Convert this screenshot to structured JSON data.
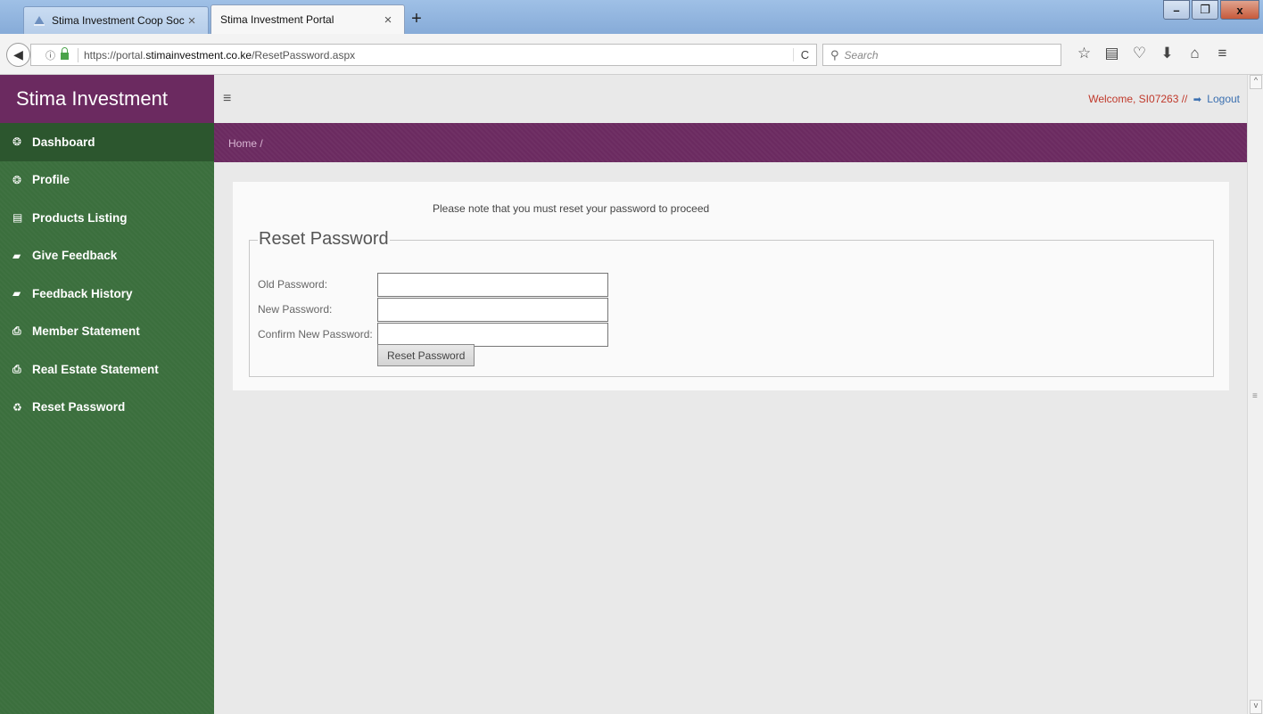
{
  "browser": {
    "tabs": [
      {
        "label": "Stima Investment Coop Soci",
        "active": false
      },
      {
        "label": "Stima Investment Portal",
        "active": true
      }
    ],
    "url_prefix": "https://portal.",
    "url_domain": "stimainvestment.co.ke",
    "url_path": "/ResetPassword.aspx",
    "search_placeholder": "Search",
    "window_buttons": {
      "minimize": "–",
      "restore": "❐",
      "close": "x"
    },
    "tab_close": "×",
    "new_tab": "+",
    "reload": "C"
  },
  "sidebar": {
    "brand": "Stima Investment",
    "items": [
      {
        "label": "Dashboard",
        "icon": "dashboard-icon",
        "glyph": "❂"
      },
      {
        "label": "Profile",
        "icon": "dashboard-icon",
        "glyph": "❂"
      },
      {
        "label": "Products Listing",
        "icon": "list-icon",
        "glyph": "▤"
      },
      {
        "label": "Give Feedback",
        "icon": "book-icon",
        "glyph": "▰"
      },
      {
        "label": "Feedback History",
        "icon": "book-icon",
        "glyph": "▰"
      },
      {
        "label": "Member Statement",
        "icon": "pdf-file-icon",
        "glyph": "⎙"
      },
      {
        "label": "Real Estate Statement",
        "icon": "pdf-file-icon",
        "glyph": "⎙"
      },
      {
        "label": "Reset Password",
        "icon": "recycle-icon",
        "glyph": "♻"
      }
    ]
  },
  "header": {
    "welcome": "Welcome, SI07263 //",
    "logout": "Logout",
    "breadcrumb": "Home  /"
  },
  "form": {
    "notice": "Please note that you must reset your password to proceed",
    "legend": "Reset Password",
    "old_password_label": "Old Password:",
    "new_password_label": "New Password:",
    "confirm_password_label": "Confirm New Password:",
    "submit_label": "Reset Password"
  }
}
